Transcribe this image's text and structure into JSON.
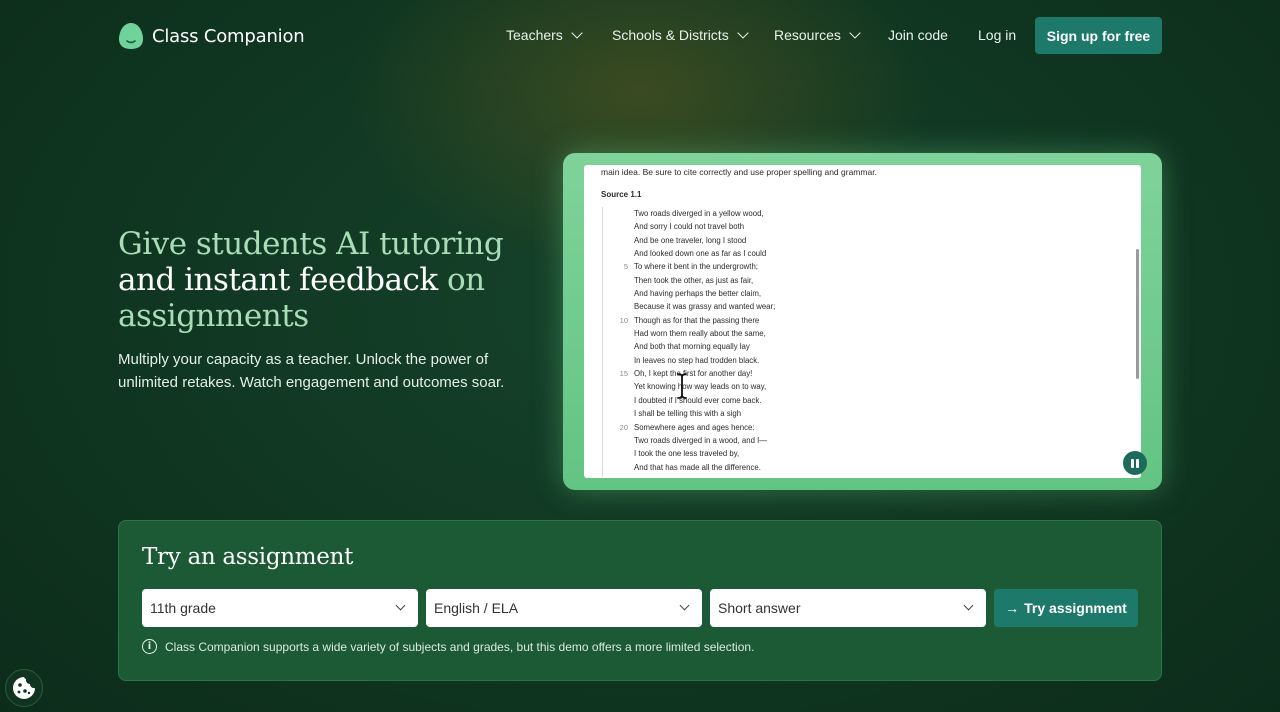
{
  "brand": {
    "name": "Class Companion"
  },
  "nav": {
    "teachers": "Teachers",
    "schools": "Schools & Districts",
    "resources": "Resources",
    "join_code": "Join code",
    "login": "Log in",
    "signup": "Sign up for free"
  },
  "hero": {
    "title_part1": "Give students AI tutoring",
    "title_part2": "and ",
    "title_highlight": "instant feedback",
    "title_part3": " on",
    "title_part4": "assignments",
    "subtitle": "Multiply your capacity as a teacher. Unlock the power of unlimited retakes. Watch engagement and outcomes soar."
  },
  "preview": {
    "instructions": "main idea. Be sure to cite correctly and use proper spelling and grammar.",
    "source_label": "Source 1.1",
    "poem_lines": [
      {
        "num": "",
        "text": "Two roads diverged in a yellow wood,"
      },
      {
        "num": "",
        "text": "And sorry I could not travel both"
      },
      {
        "num": "",
        "text": "And be one traveler, long I stood"
      },
      {
        "num": "",
        "text": "And looked down one as far as I could"
      },
      {
        "num": "5",
        "text": "To where it bent in the undergrowth;"
      },
      {
        "num": "",
        "text": "Then took the other, as just as fair,"
      },
      {
        "num": "",
        "text": "And having perhaps the better claim,"
      },
      {
        "num": "",
        "text": "Because it was grassy and wanted wear;"
      },
      {
        "num": "10",
        "text": "Though as for that the passing there"
      },
      {
        "num": "",
        "text": "Had worn them really about the same,"
      },
      {
        "num": "",
        "text": "And both that morning equally lay"
      },
      {
        "num": "",
        "text": "In leaves no step had trodden black."
      },
      {
        "num": "15",
        "text": "Oh, I kept the first for another day!"
      },
      {
        "num": "",
        "text": "Yet knowing how way leads on to way,"
      },
      {
        "num": "",
        "text": "I doubted if I should ever come back."
      },
      {
        "num": "",
        "text": "I shall be telling this with a sigh"
      },
      {
        "num": "20",
        "text": "Somewhere ages and ages hence:"
      },
      {
        "num": "",
        "text": "Two roads diverged in a wood, and I—"
      },
      {
        "num": "",
        "text": "I took the one less traveled by,"
      },
      {
        "num": "",
        "text": "And that has made all the difference."
      }
    ]
  },
  "try": {
    "title": "Try an assignment",
    "grade": "11th grade",
    "subject": "English / ELA",
    "type": "Short answer",
    "button": "Try assignment",
    "button_arrow": "→",
    "info_glyph": "i",
    "info": "Class Companion supports a wide variety of subjects and grades, but this demo offers a more limited selection."
  },
  "colors": {
    "accent": "#1d7a6a",
    "bg_dark": "#0f3520",
    "hero_light": "#a8ddb8",
    "panel": "#1c5a36"
  },
  "icons": [
    "logo-icon",
    "chevron-down-icon",
    "pause-icon",
    "text-cursor-icon",
    "info-icon",
    "arrow-right-icon",
    "cookie-icon"
  ]
}
